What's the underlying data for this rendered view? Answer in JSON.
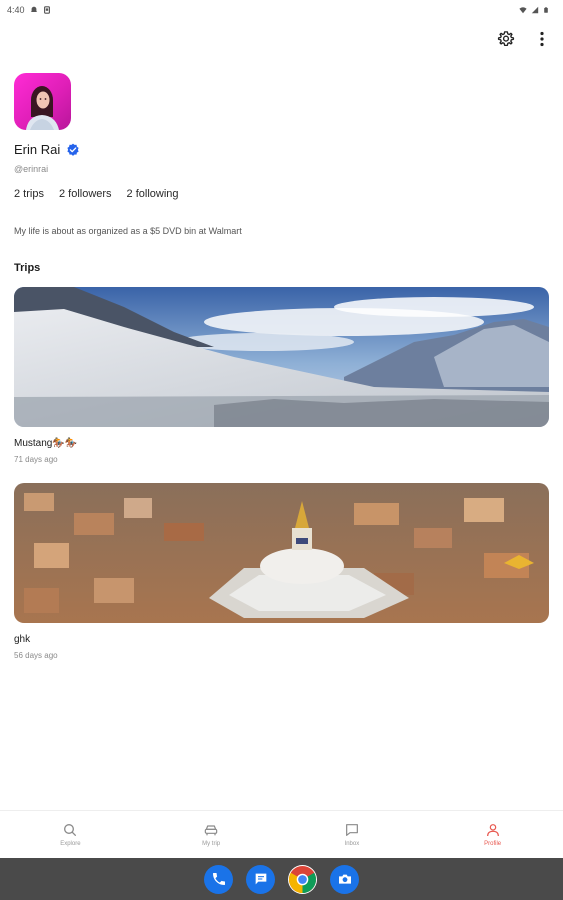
{
  "status_bar": {
    "time": "4:40",
    "icons": [
      "notification-icon",
      "screenshot-icon",
      "wifi-icon",
      "signal-icon",
      "battery-icon"
    ]
  },
  "top_actions": {
    "icons": [
      "settings-gear-icon",
      "more-vertical-icon"
    ]
  },
  "profile": {
    "name": "Erin Rai",
    "handle": "@erinrai",
    "verified_icon": "verified-badge-icon",
    "stats": {
      "trips": "2 trips",
      "followers": "2 followers",
      "following": "2 following"
    },
    "bio": "My life is about as organized as a $5 DVD bin at Walmart"
  },
  "trips_section": {
    "title": "Trips",
    "items": [
      {
        "name": "Mustang🏇🏇",
        "date": "71 days ago",
        "image": "snowy-mountain-landscape"
      },
      {
        "name": "ghk",
        "date": "56 days ago",
        "image": "stupa-city-aerial"
      }
    ]
  },
  "bottom_nav": {
    "items": [
      {
        "label": "Explore",
        "icon": "search-icon",
        "active": false
      },
      {
        "label": "My trip",
        "icon": "car-icon",
        "active": false
      },
      {
        "label": "Inbox",
        "icon": "chat-icon",
        "active": false
      },
      {
        "label": "Profile",
        "icon": "person-icon",
        "active": true
      }
    ]
  },
  "dock": {
    "apps": [
      "phone-app-icon",
      "messages-app-icon",
      "chrome-app-icon",
      "camera-app-icon"
    ]
  },
  "colors": {
    "accent": "#e8584f",
    "verified": "#2563eb",
    "dock_bg": "#4a4a4a"
  }
}
